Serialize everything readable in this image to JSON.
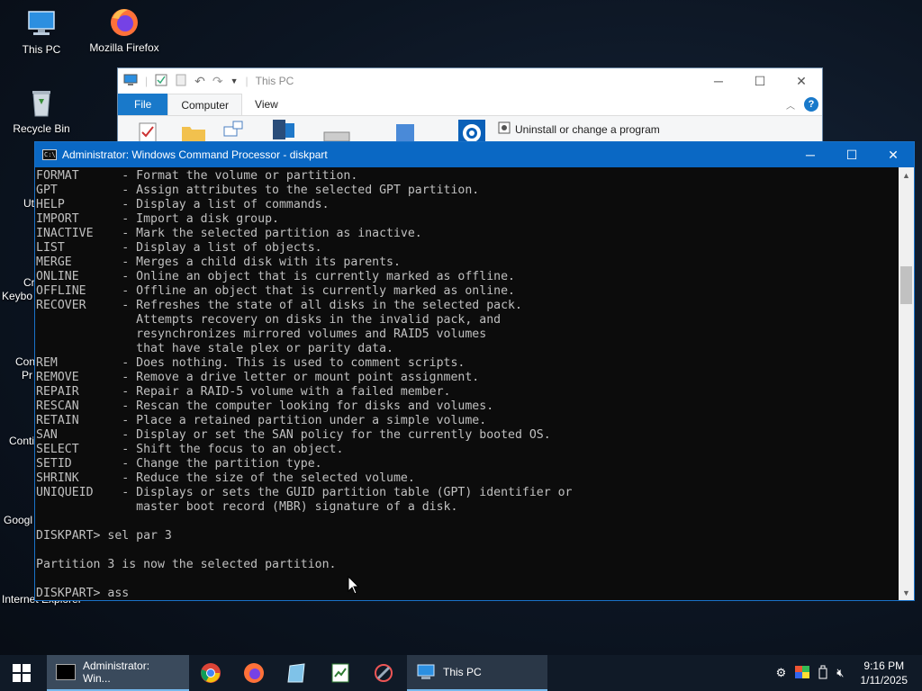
{
  "desktop": {
    "icons": [
      {
        "label": "This PC"
      },
      {
        "label": "Mozilla Firefox"
      },
      {
        "label": "Recycle Bin"
      }
    ],
    "partial_labels": [
      "Ut",
      "Cr",
      "Keybo",
      "Con",
      "Pr",
      "Conti",
      "Googl",
      "Internet Explorer"
    ]
  },
  "explorer": {
    "title": "This PC",
    "tabs": [
      "File",
      "Computer",
      "View"
    ],
    "uninstall_label": "Uninstall or change a program",
    "help": "?"
  },
  "cmd": {
    "title": "Administrator: Windows Command Processor - diskpart",
    "lines": [
      "FORMAT      - Format the volume or partition.",
      "GPT         - Assign attributes to the selected GPT partition.",
      "HELP        - Display a list of commands.",
      "IMPORT      - Import a disk group.",
      "INACTIVE    - Mark the selected partition as inactive.",
      "LIST        - Display a list of objects.",
      "MERGE       - Merges a child disk with its parents.",
      "ONLINE      - Online an object that is currently marked as offline.",
      "OFFLINE     - Offline an object that is currently marked as online.",
      "RECOVER     - Refreshes the state of all disks in the selected pack.",
      "              Attempts recovery on disks in the invalid pack, and",
      "              resynchronizes mirrored volumes and RAID5 volumes",
      "              that have stale plex or parity data.",
      "REM         - Does nothing. This is used to comment scripts.",
      "REMOVE      - Remove a drive letter or mount point assignment.",
      "REPAIR      - Repair a RAID-5 volume with a failed member.",
      "RESCAN      - Rescan the computer looking for disks and volumes.",
      "RETAIN      - Place a retained partition under a simple volume.",
      "SAN         - Display or set the SAN policy for the currently booted OS.",
      "SELECT      - Shift the focus to an object.",
      "SETID       - Change the partition type.",
      "SHRINK      - Reduce the size of the selected volume.",
      "UNIQUEID    - Displays or sets the GUID partition table (GPT) identifier or",
      "              master boot record (MBR) signature of a disk.",
      "",
      "DISKPART> sel par 3",
      "",
      "Partition 3 is now the selected partition.",
      "",
      "DISKPART> ass"
    ]
  },
  "taskbar": {
    "apps": [
      {
        "label": "Administrator: Win..."
      },
      {
        "label": "This PC"
      }
    ],
    "time": "9:16 PM",
    "date": "1/11/2025"
  },
  "colors": {
    "cmd_title": "#0a68c4",
    "console_text": "#c0c0c0",
    "accent": "#1979ca"
  }
}
